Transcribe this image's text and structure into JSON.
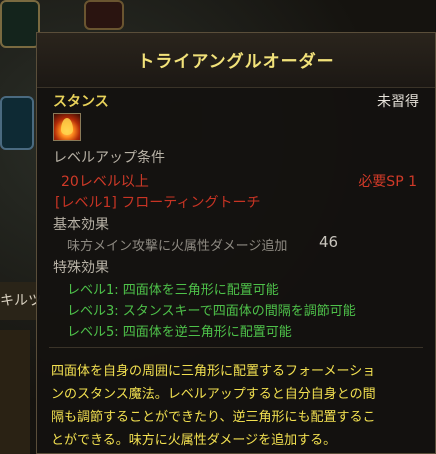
{
  "background": {
    "side_label": "キルツリー"
  },
  "tooltip": {
    "title": "トライアングルオーダー",
    "stance_label": "スタンス",
    "status": "未習得",
    "icon": "flame-stance-icon",
    "levelup_header": "レベルアップ条件",
    "required_level": "20レベル以上",
    "required_sp": "必要SP 1",
    "required_skill": "[レベル1] フローティングトーチ",
    "basic_effect_header": "基本効果",
    "basic_effect_desc": "味方メイン攻撃に火属性ダメージ追加",
    "basic_effect_value": "46",
    "special_effect_header": "特殊効果",
    "special_effects": [
      "レベル1: 四面体を三角形に配置可能",
      "レベル3: スタンスキーで四面体の間隔を調節可能",
      "レベル5: 四面体を逆三角形に配置可能"
    ],
    "description_lines": [
      "四面体を自身の周囲に三角形に配置するフォーメーショ",
      "ンのスタンス魔法。レベルアップすると自分自身との間",
      "隔も調節することができたり、逆三角形にも配置するこ",
      "とができる。味方に火属性ダメージを追加する。"
    ],
    "colors": {
      "title": "#f2e27a",
      "requirement": "#d03a28",
      "special_effect": "#4ec24a",
      "description": "#f2e050"
    }
  }
}
